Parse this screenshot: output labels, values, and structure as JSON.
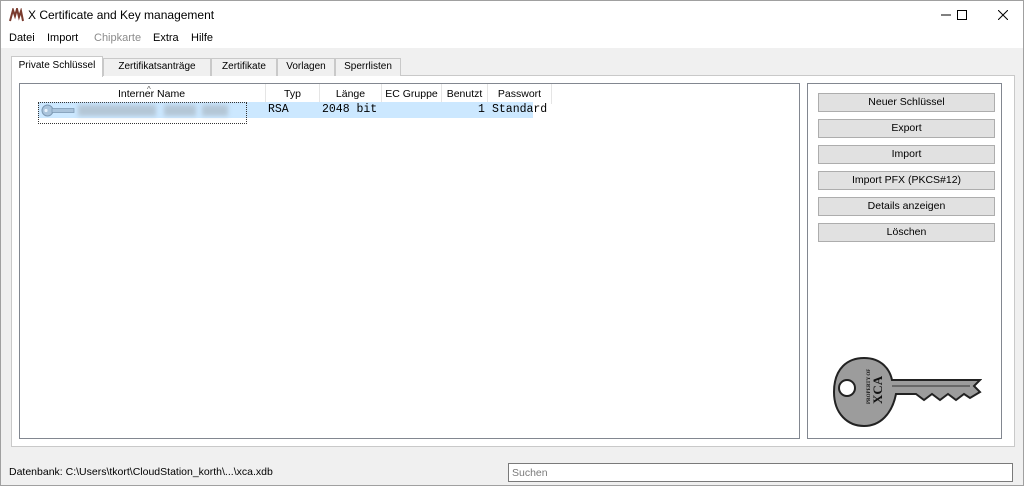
{
  "window": {
    "title": "X Certificate and Key management"
  },
  "menu": [
    {
      "label": "Datei",
      "disabled": false
    },
    {
      "label": "Import",
      "disabled": false
    },
    {
      "label": "Chipkarte",
      "disabled": true
    },
    {
      "label": "Extra",
      "disabled": false
    },
    {
      "label": "Hilfe",
      "disabled": false
    }
  ],
  "tabs": [
    {
      "label": "Private Schlüssel",
      "active": true
    },
    {
      "label": "Zertifikatsanträge",
      "active": false
    },
    {
      "label": "Zertifikate",
      "active": false
    },
    {
      "label": "Vorlagen",
      "active": false
    },
    {
      "label": "Sperrlisten",
      "active": false
    }
  ],
  "table": {
    "columns": [
      "Interner Name",
      "Typ",
      "Länge",
      "EC Gruppe",
      "Benutzt",
      "Passwort"
    ],
    "sort_column": "Interner Name",
    "rows": [
      {
        "name": "",
        "typ": "RSA",
        "laenge": "2048 bit",
        "ec_gruppe": "",
        "benutzt": "1",
        "passwort": "Standard",
        "selected": true
      }
    ]
  },
  "buttons": {
    "new_key": "Neuer Schlüssel",
    "export": "Export",
    "import": "Import",
    "import_pfx": "Import PFX (PKCS#12)",
    "details": "Details anzeigen",
    "delete": "Löschen"
  },
  "logo": {
    "text": "XCA",
    "small_text": "PROPERTY OF"
  },
  "status": {
    "database_label": "Datenbank: C:\\Users\\tkort\\CloudStation_korth\\...\\xca.xdb",
    "search_placeholder": "Suchen",
    "search_value": ""
  },
  "colors": {
    "selection": "#cce8ff",
    "window_bg": "#f0f0f0",
    "button_bg": "#e1e1e1"
  }
}
